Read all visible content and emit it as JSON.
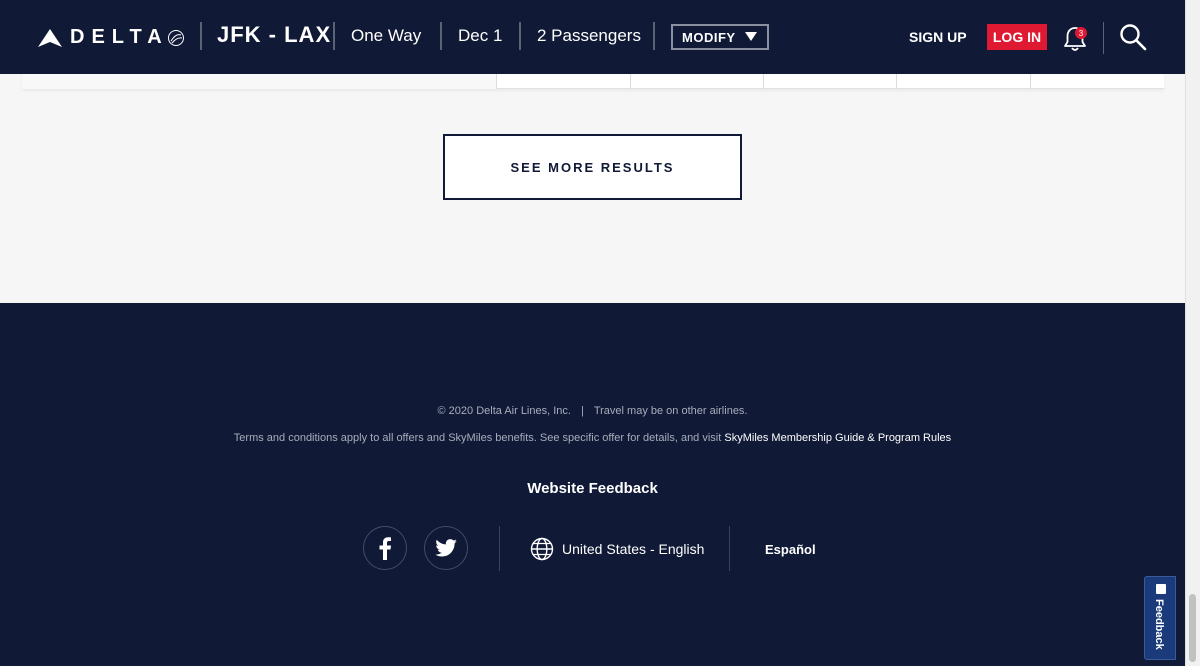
{
  "header": {
    "brand": "DELTA",
    "route": "JFK - LAX",
    "trip_type": "One Way",
    "date": "Dec 1",
    "passengers": "2 Passengers",
    "modify_label": "MODIFY",
    "signup_label": "SIGN UP",
    "login_label": "LOG IN",
    "notification_count": "3"
  },
  "results": {
    "see_more_label": "SEE MORE RESULTS"
  },
  "footer": {
    "copyright": "© 2020 Delta Air Lines, Inc.",
    "separator": "|",
    "other_airlines": "Travel may be on other airlines.",
    "terms_text": "Terms and conditions apply to all offers and SkyMiles benefits. See specific offer for details, and visit ",
    "terms_link": "SkyMiles Membership Guide & Program Rules",
    "website_feedback": "Website Feedback",
    "locale": "United States - English",
    "alt_language": "Español"
  },
  "feedback_tab": {
    "label": "Feedback"
  },
  "colors": {
    "navy": "#101936",
    "red": "#e01933",
    "page_bg": "#f6f6f6"
  }
}
